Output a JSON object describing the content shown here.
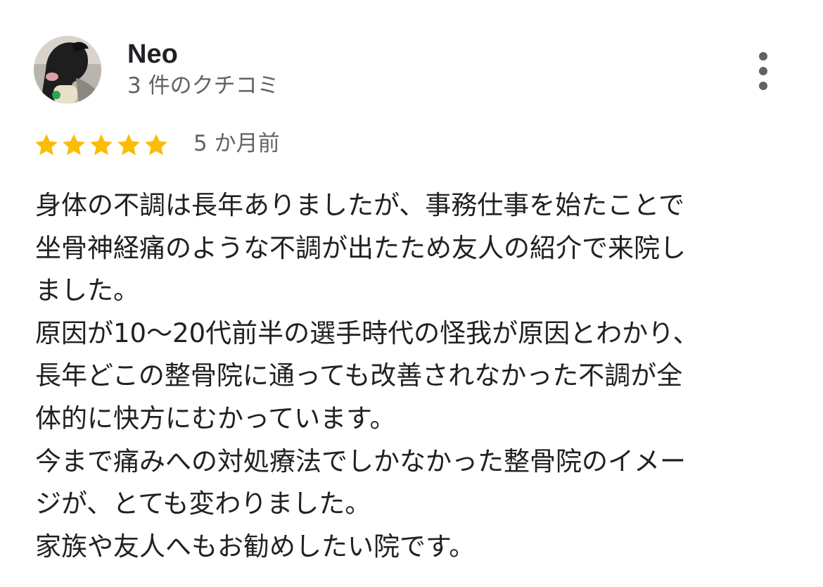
{
  "reviewer": {
    "name": "Neo",
    "review_count": "3 件のクチコミ"
  },
  "rating": {
    "stars": 5,
    "max": 5,
    "color": "#fbbc04"
  },
  "timestamp": "5 か月前",
  "review": {
    "lines": [
      "身体の不調は長年ありましたが、事務仕事を始たことで",
      "坐骨神経痛のような不調が出たため友人の紹介で来院し",
      "ました。",
      "原因が10〜20代前半の選手時代の怪我が原因とわかり、",
      "長年どこの整骨院に通っても改善されなかった不調が全",
      "体的に快方にむかっています。",
      "今まで痛みへの対処療法でしかなかった整骨院のイメー",
      "ジが、とても変わりました。",
      "家族や友人へもお勧めしたい院です。"
    ]
  },
  "icons": {
    "menu": "more-vert-icon",
    "star": "star-icon"
  },
  "colors": {
    "text_primary": "#202124",
    "text_secondary": "#5f6368",
    "star": "#fbbc04"
  }
}
